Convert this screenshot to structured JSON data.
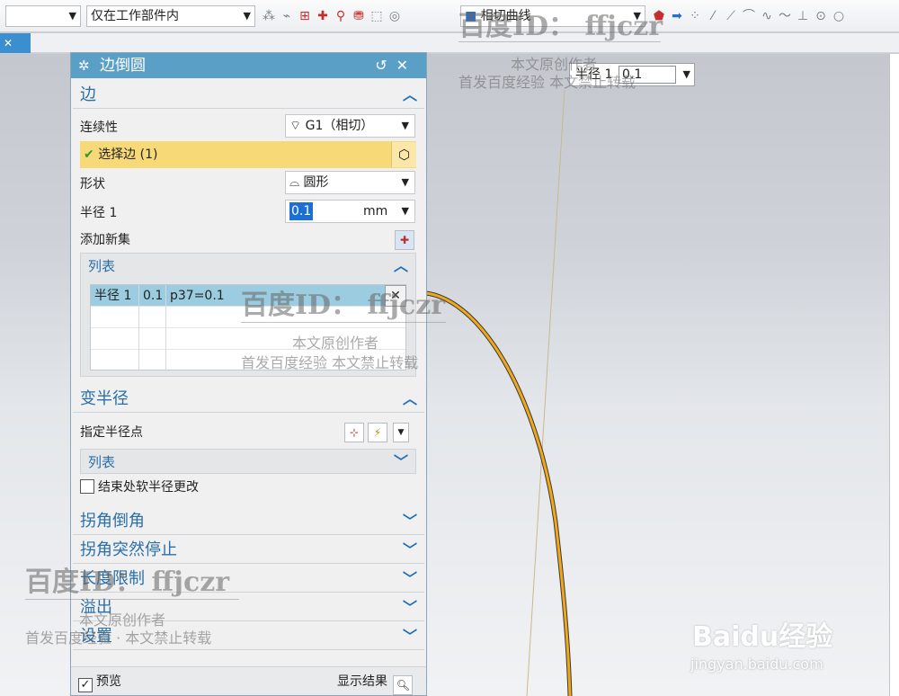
{
  "toolbar": {
    "filter_select": "",
    "scope_select": "仅在工作部件内",
    "curve_rule_select": "相切曲线"
  },
  "float_radius": {
    "label": "半径 1",
    "value": "0.1"
  },
  "dialog": {
    "title": "边倒圆",
    "sections": {
      "edge": {
        "title": "边",
        "continuity_label": "连续性",
        "continuity_value": "G1（相切）",
        "select_edge_label": "选择边 (1)",
        "shape_label": "形状",
        "shape_value": "圆形",
        "radius_label": "半径 1",
        "radius_value": "0.1",
        "radius_unit": "mm",
        "add_new_set_label": "添加新集",
        "list": {
          "title": "列表",
          "rows": [
            {
              "c1": "半径 1",
              "c2": "0.1",
              "c3": "p37=0.1"
            }
          ]
        }
      },
      "variable_radius": {
        "title": "变半径",
        "specify_point_label": "指定半径点",
        "list_title": "列表",
        "soft_radius_change_label": "结束处软半径更改"
      },
      "corner_setback": {
        "title": "拐角倒角"
      },
      "corner_stop": {
        "title": "拐角突然停止"
      },
      "length_limit": {
        "title": "长度限制"
      },
      "overflow": {
        "title": "溢出"
      },
      "settings": {
        "title": "设置"
      }
    },
    "footer": {
      "preview_label": "预览",
      "show_result_label": "显示结果"
    }
  },
  "watermarks": {
    "id_text": "百度ID： ffjczr",
    "author_text": "本文原创作者",
    "notice_text": "首发百度经验   本文禁止转载",
    "notice_text_2": "首发百度经验  ·  本文禁止转载",
    "baidu_logo": "Baidu经验",
    "baidu_url": "jingyan.baidu.com"
  }
}
